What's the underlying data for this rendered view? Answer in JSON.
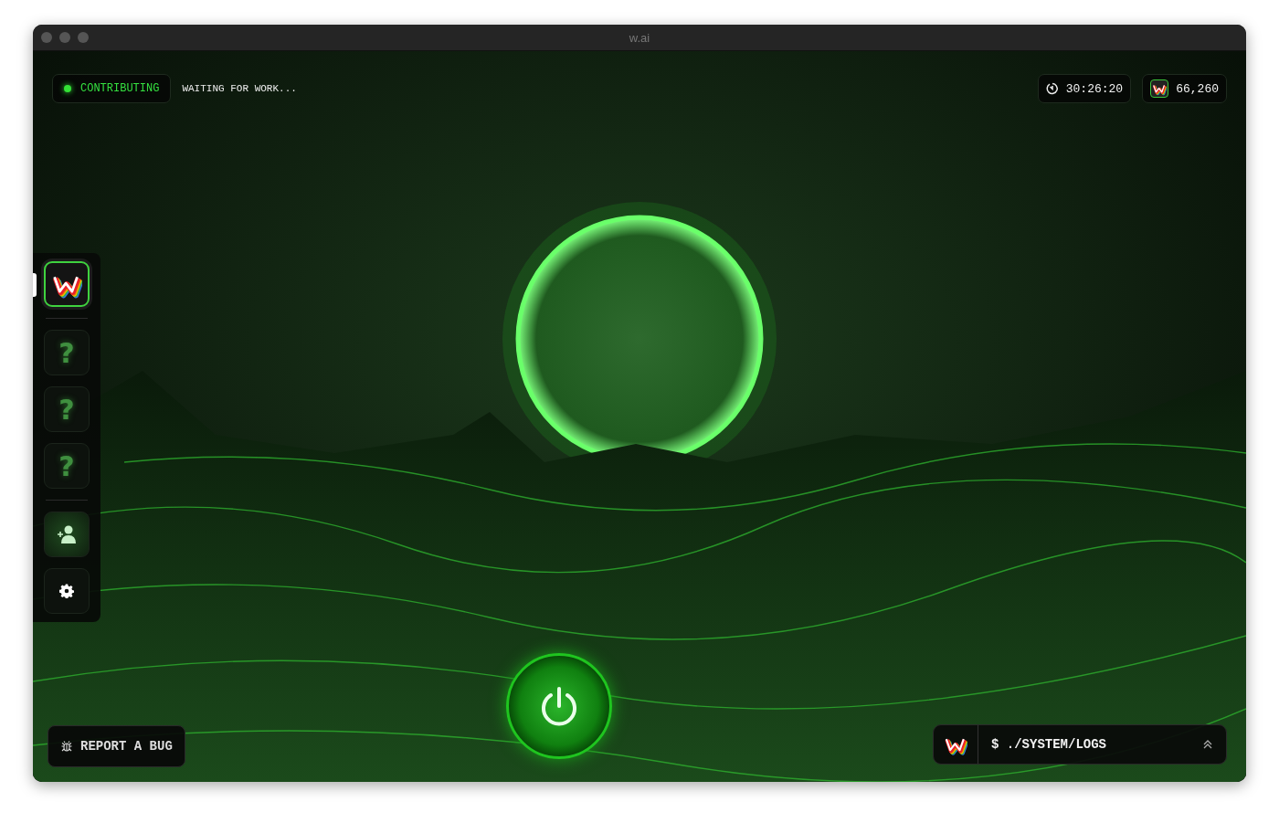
{
  "window": {
    "title": "w.ai"
  },
  "status": {
    "label": "CONTRIBUTING",
    "active": true,
    "message": "WAITING FOR WORK..."
  },
  "timer": {
    "value": "30:26:20"
  },
  "points": {
    "value": "66,260"
  },
  "sidebar": {
    "items": [
      {
        "kind": "app",
        "selected": true
      },
      {
        "kind": "locked",
        "label": "?",
        "selected": false
      },
      {
        "kind": "locked",
        "label": "?",
        "selected": false
      },
      {
        "kind": "locked",
        "label": "?",
        "selected": false
      },
      {
        "kind": "invite",
        "selected": false
      },
      {
        "kind": "settings",
        "selected": false
      }
    ]
  },
  "report_button": {
    "label": "REPORT A BUG"
  },
  "power": {
    "on": true
  },
  "logs": {
    "label": "$ ./SYSTEM/LOGS"
  }
}
